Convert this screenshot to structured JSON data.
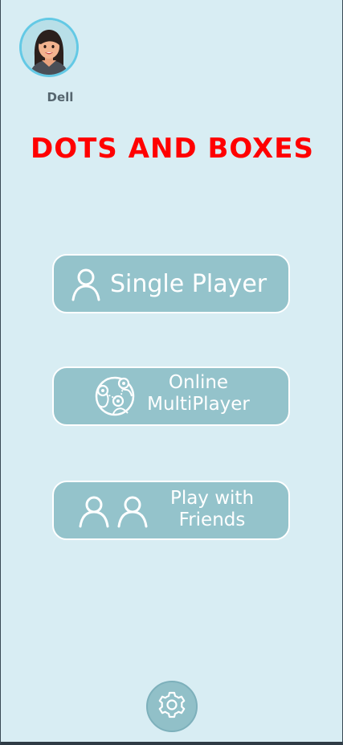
{
  "profile": {
    "username": "Dell",
    "avatar_icon": "girl-avatar-icon"
  },
  "title": "DOTS AND BOXES",
  "menu": {
    "single": {
      "label": "Single Player",
      "icon": "person-icon"
    },
    "online": {
      "line1": "Online",
      "line2": "MultiPlayer",
      "icon": "globe-network-icon"
    },
    "friends": {
      "line1": "Play with",
      "line2": "Friends",
      "icon": "two-people-icon"
    }
  },
  "settings": {
    "icon": "gear-icon"
  },
  "colors": {
    "background": "#d8edf3",
    "title": "#ff0000",
    "button": "#94c3cb",
    "button_border": "#ffffff",
    "avatar_ring": "#63c9e5"
  }
}
